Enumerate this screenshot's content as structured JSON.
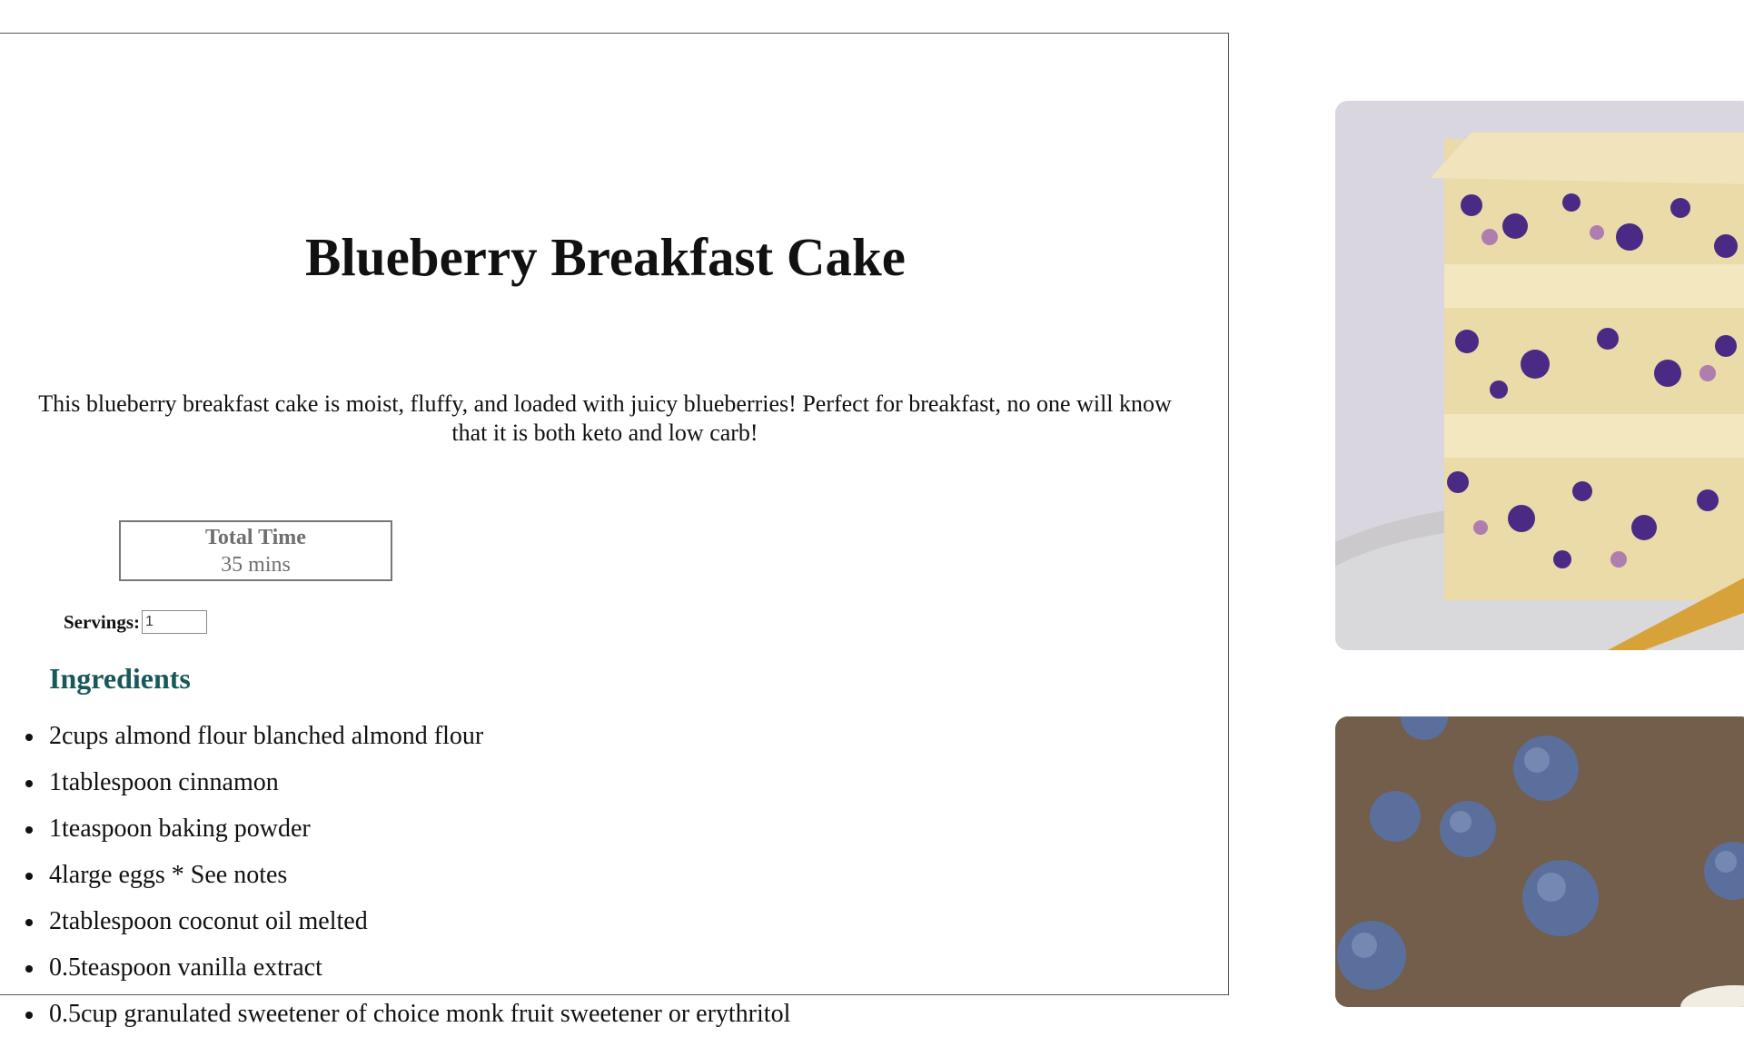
{
  "recipe": {
    "title": "Blueberry Breakfast Cake",
    "description": "This blueberry breakfast cake is moist, fluffy, and loaded with juicy blueberries! Perfect for breakfast, no one will know that it is both keto and low carb!",
    "total_time": {
      "label": "Total Time",
      "value": "35 mins"
    },
    "servings": {
      "label": "Servings:",
      "value": "1"
    },
    "ingredients_heading": "Ingredients",
    "ingredients": [
      "2cups almond flour blanched almond flour",
      "1tablespoon cinnamon",
      "1teaspoon baking powder",
      "4large eggs * See notes",
      "2tablespoon coconut oil melted",
      "0.5teaspoon vanilla extract",
      "0.5cup granulated sweetener of choice monk fruit sweetener or erythritol"
    ]
  },
  "images": [
    {
      "name": "blueberry-cake-slice",
      "colors": {
        "background": "#d9d6df",
        "cake": "#eadba8",
        "berry": "#4b2a86",
        "plate": "#c8c6c9",
        "fork": "#d8a23a"
      }
    },
    {
      "name": "blueberries-on-tray",
      "colors": {
        "background": "#7e6953",
        "berry": "#5a6f9c"
      }
    }
  ]
}
